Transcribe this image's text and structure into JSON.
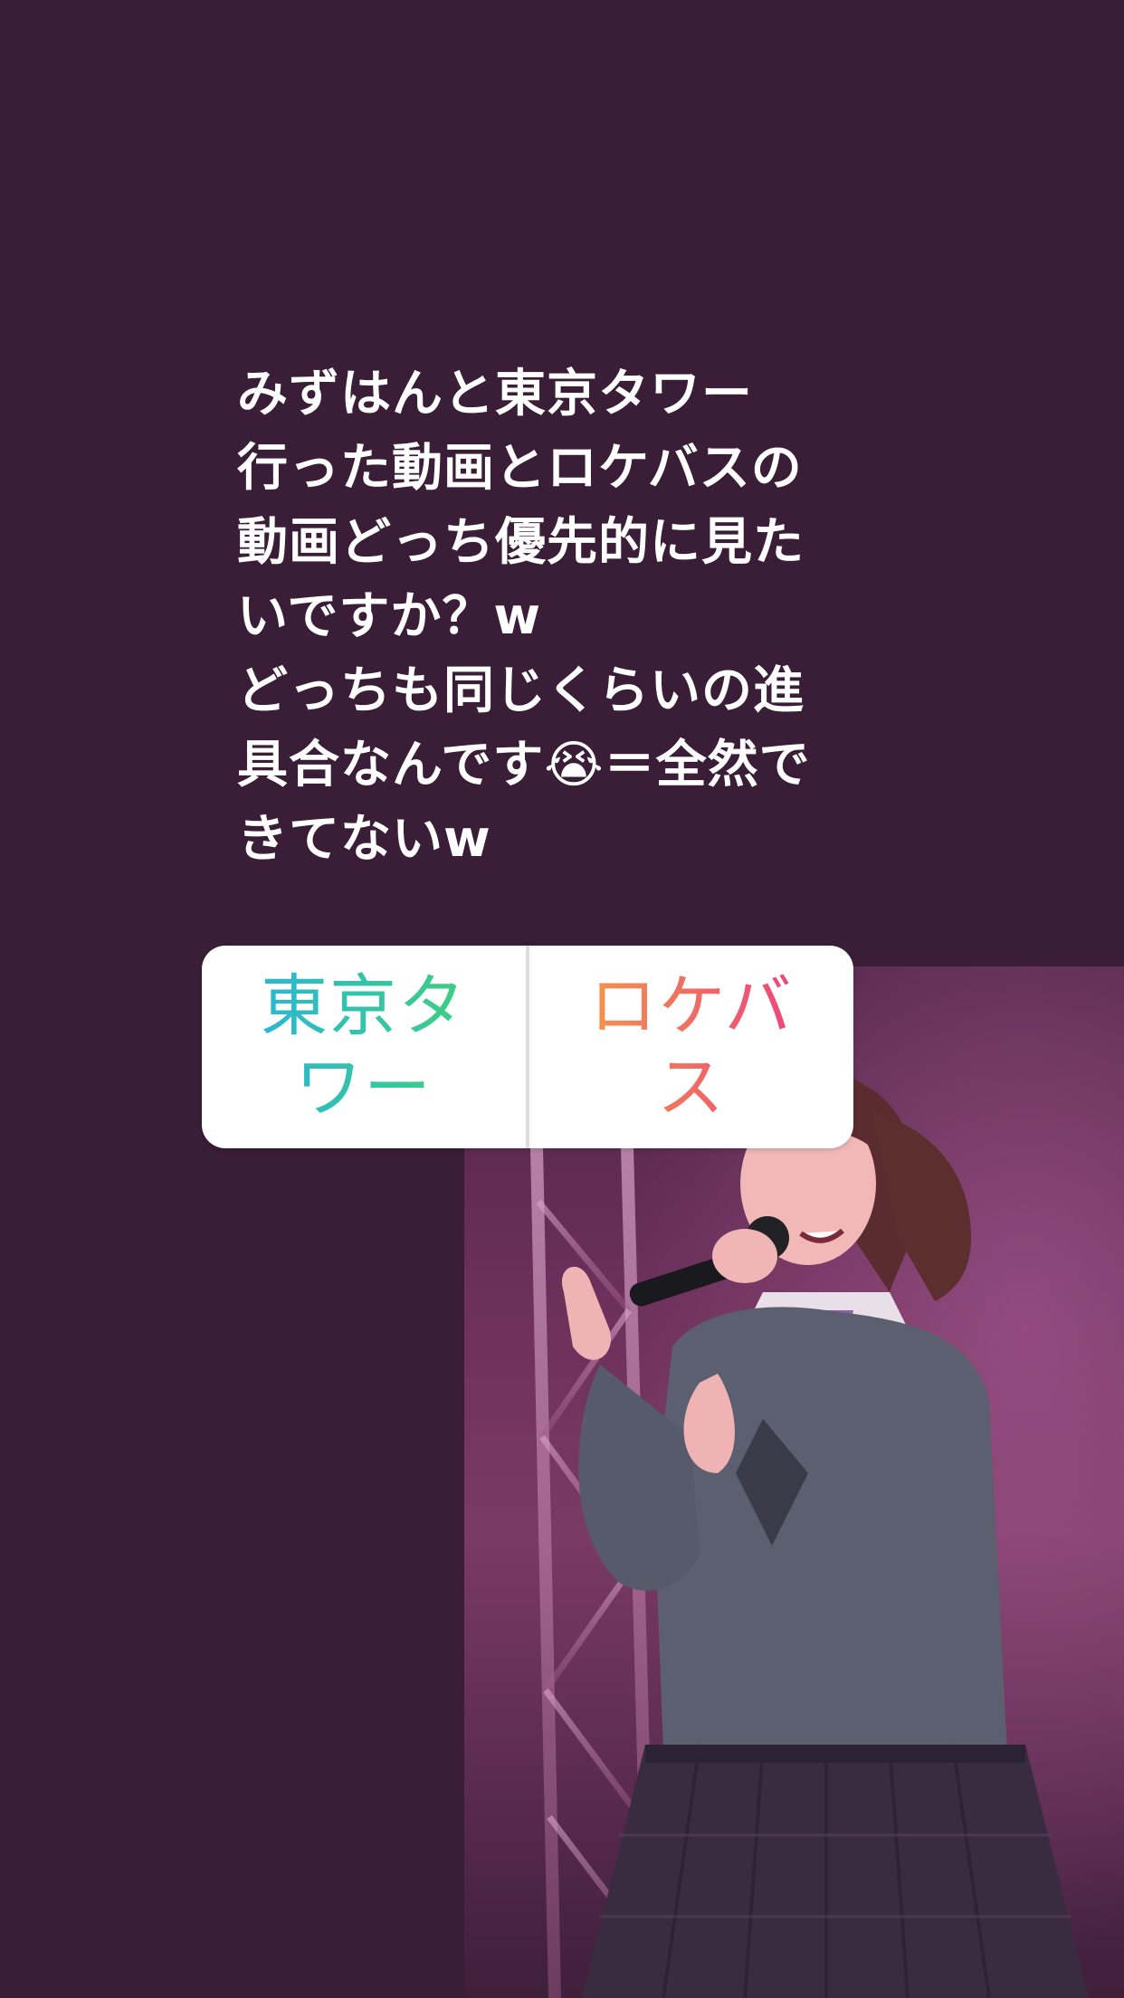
{
  "story": {
    "background_color": "#3a1d36",
    "caption": "みずはんと東京タワー\n行った動画とロケバスの\n動画どっち優先的に見た\nいですか？w\nどっちも同じくらいの進\n具合なんです😭＝全然で\nきてないw"
  },
  "poll": {
    "option_a": "東京タワー",
    "option_b": "ロケバス",
    "option_a_gradient": [
      "#2bb5d8",
      "#3fd17a"
    ],
    "option_b_gradient": [
      "#f39a4a",
      "#ee3f7e"
    ]
  },
  "photo": {
    "subject": "performer-singing-with-microphone"
  }
}
